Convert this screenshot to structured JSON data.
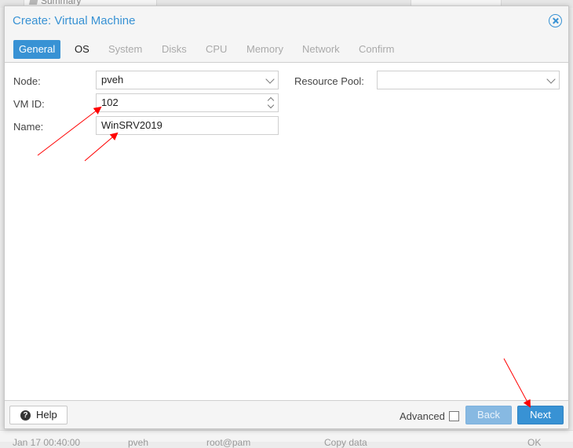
{
  "background": {
    "summary_label": "Summary",
    "log_row": [
      "Jan 17 00:40:00",
      "pveh",
      "root@pam",
      "Copy data",
      "OK"
    ]
  },
  "window": {
    "title": "Create: Virtual Machine",
    "close_icon": "close-circle-icon"
  },
  "tabs": [
    {
      "label": "General",
      "state": "active"
    },
    {
      "label": "OS",
      "state": "enabled"
    },
    {
      "label": "System",
      "state": "disabled"
    },
    {
      "label": "Disks",
      "state": "disabled"
    },
    {
      "label": "CPU",
      "state": "disabled"
    },
    {
      "label": "Memory",
      "state": "disabled"
    },
    {
      "label": "Network",
      "state": "disabled"
    },
    {
      "label": "Confirm",
      "state": "disabled"
    }
  ],
  "form": {
    "node_label": "Node:",
    "node_value": "pveh",
    "vmid_label": "VM ID:",
    "vmid_value": "102",
    "name_label": "Name:",
    "name_value": "WinSRV2019",
    "pool_label": "Resource Pool:",
    "pool_value": ""
  },
  "footer": {
    "help_label": "Help",
    "advanced_label": "Advanced",
    "advanced_checked": false,
    "back_label": "Back",
    "next_label": "Next"
  },
  "colors": {
    "accent": "#3892d4",
    "annotation": "#ff0000"
  }
}
